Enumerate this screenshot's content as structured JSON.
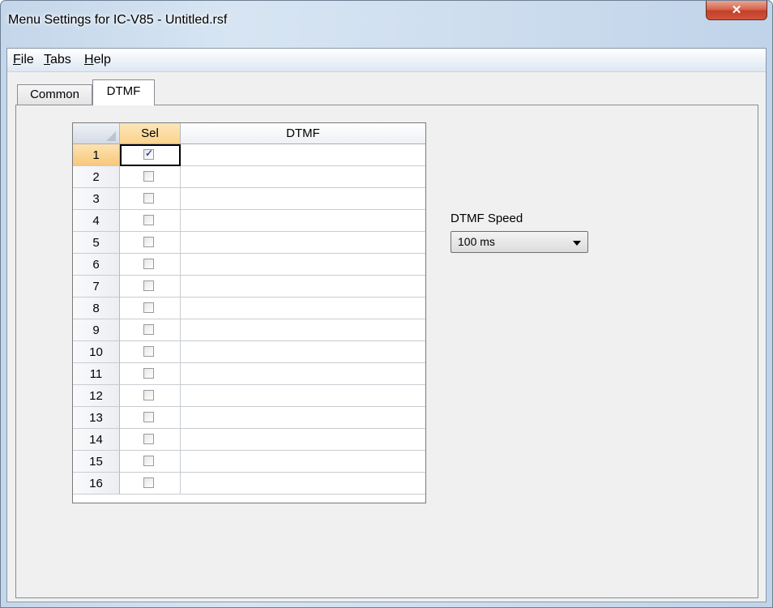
{
  "window": {
    "title": "Menu Settings for IC-V85 - Untitled.rsf",
    "close_glyph": "✕"
  },
  "menu": {
    "items": [
      {
        "accel": "F",
        "rest": "ile"
      },
      {
        "accel": "T",
        "rest": "abs"
      },
      {
        "accel": "H",
        "rest": "elp"
      }
    ]
  },
  "tabs": [
    {
      "label": "Common",
      "active": false
    },
    {
      "label": "DTMF",
      "active": true
    }
  ],
  "grid": {
    "columns": [
      "Sel",
      "DTMF"
    ],
    "rows": [
      {
        "num": "1",
        "sel": true,
        "dtmf": ""
      },
      {
        "num": "2",
        "sel": false,
        "dtmf": ""
      },
      {
        "num": "3",
        "sel": false,
        "dtmf": ""
      },
      {
        "num": "4",
        "sel": false,
        "dtmf": ""
      },
      {
        "num": "5",
        "sel": false,
        "dtmf": ""
      },
      {
        "num": "6",
        "sel": false,
        "dtmf": ""
      },
      {
        "num": "7",
        "sel": false,
        "dtmf": ""
      },
      {
        "num": "8",
        "sel": false,
        "dtmf": ""
      },
      {
        "num": "9",
        "sel": false,
        "dtmf": ""
      },
      {
        "num": "10",
        "sel": false,
        "dtmf": ""
      },
      {
        "num": "11",
        "sel": false,
        "dtmf": ""
      },
      {
        "num": "12",
        "sel": false,
        "dtmf": ""
      },
      {
        "num": "13",
        "sel": false,
        "dtmf": ""
      },
      {
        "num": "14",
        "sel": false,
        "dtmf": ""
      },
      {
        "num": "15",
        "sel": false,
        "dtmf": ""
      },
      {
        "num": "16",
        "sel": false,
        "dtmf": ""
      }
    ]
  },
  "dtmf_speed": {
    "label": "DTMF Speed",
    "value": "100 ms"
  },
  "colors": {
    "selected_header": "#fbd38e",
    "checkmark": "#2a4fa8",
    "close_button": "#c2402a"
  },
  "icons": [
    "close-icon",
    "checkmark-icon",
    "dropdown-arrow-icon"
  ]
}
